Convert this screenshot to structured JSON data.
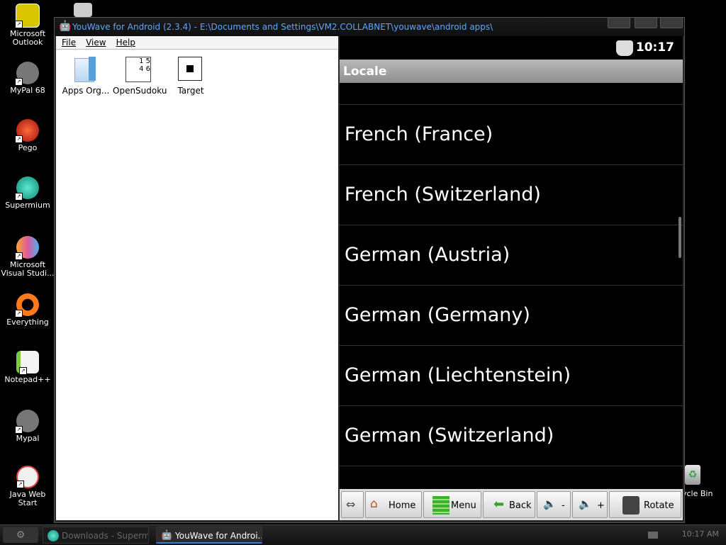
{
  "desktop_icons": [
    {
      "label": "Microsoft Outlook",
      "icon": "outlook-icon",
      "color": "#d8c400"
    },
    {
      "label": "MyPal 68",
      "icon": "mypal-icon",
      "color": "#888888"
    },
    {
      "label": "Pego",
      "icon": "pego-icon",
      "color": "#d8341c"
    },
    {
      "label": "Supermium",
      "icon": "supermium-icon",
      "color": "#1fb8a0"
    },
    {
      "label": "Microsoft Visual Studi...",
      "icon": "visual-studio-icon",
      "color": "#e05aa0"
    },
    {
      "label": "Everything",
      "icon": "everything-icon",
      "color": "#ff7a1a"
    },
    {
      "label": "Notepad++",
      "icon": "notepadpp-icon",
      "color": "#7ac943"
    },
    {
      "label": "Mypal",
      "icon": "mypal-icon",
      "color": "#888888"
    },
    {
      "label": "Java Web Start",
      "icon": "java-icon",
      "color": "#e04040"
    }
  ],
  "recycle_bin": {
    "label": "ycle Bin",
    "icon": "recycle-bin-icon"
  },
  "window": {
    "title": "YouWave for Android (2.3.4) - E:\\Documents and Settings\\VM2.COLLABNET\\youwave\\android apps\\"
  },
  "explorer": {
    "menu": [
      "File",
      "View",
      "Help"
    ],
    "files": [
      {
        "label": "Apps Org...",
        "icon": "apps-organizer-icon"
      },
      {
        "label": "OpenSudoku",
        "icon": "opensudoku-icon"
      },
      {
        "label": "Target",
        "icon": "target-word-icon"
      }
    ]
  },
  "android": {
    "clock": "10:17",
    "header": "Locale",
    "locales": [
      "French (France)",
      "French (Switzerland)",
      "German (Austria)",
      "German (Germany)",
      "German (Liechtenstein)",
      "German (Switzerland)"
    ],
    "nav": {
      "home": "Home",
      "menu": "Menu",
      "back": "Back",
      "vol_down": "-",
      "vol_up": "+",
      "rotate": "Rotate"
    }
  },
  "taskbar": {
    "tasks": [
      {
        "label": "Downloads - Superm...",
        "active": false
      },
      {
        "label": "YouWave for Androi...",
        "active": true
      }
    ],
    "tray_time": "10:17 AM"
  }
}
